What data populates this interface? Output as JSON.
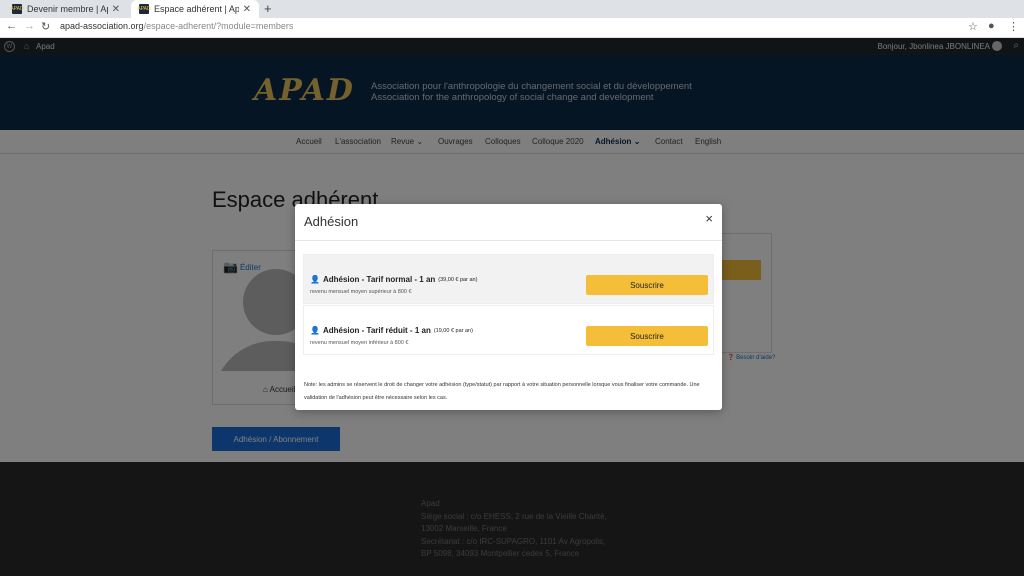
{
  "browser": {
    "tabs": [
      {
        "title": "Devenir membre | Apad",
        "close": "✕",
        "favicon": "APAD"
      },
      {
        "title": "Espace adhérent | Apad",
        "close": "✕",
        "favicon": "APAD"
      }
    ],
    "new_tab": "+",
    "url_host": "apad-association.org",
    "url_path": "/espace-adherent/?module=members"
  },
  "wpbar": {
    "site_name": "Apad",
    "greeting": "Bonjour, Jbonlinea JBONLINEA"
  },
  "header": {
    "logo": "APAD",
    "tagline_fr": "Association pour l'anthropologie du changement social et du développement",
    "tagline_en": "Association for the anthropology of social change and development"
  },
  "nav": {
    "items": [
      "Accueil",
      "L'association",
      "Revue",
      "Ouvrages",
      "Colloques",
      "Colloque 2020",
      "Adhésion",
      "Contact",
      "English"
    ]
  },
  "page": {
    "title": "Espace adhérent",
    "edit_label": "Éditer",
    "home_label": "Accueil",
    "subscription_button": "Adhésion / Abonnement",
    "help_label": "Besoin d'aide?"
  },
  "footer": {
    "lines": [
      "Apad",
      "Siège social : c/o EHESS, 2 rue de la Vieille Charité,",
      "13002 Marseille, France",
      "Secrétariat : c/o IRC-SUPAGRO, 1101 Av Agropolis,",
      "BP 5098, 34093 Montpellier cedex 5, France"
    ]
  },
  "modal": {
    "title": "Adhésion",
    "close": "×",
    "plans": [
      {
        "name": "Adhésion - Tarif normal - 1 an",
        "price": "(39,00 € par an)",
        "desc": "revenu mensuel moyen supérieur à 800 €",
        "button": "Souscrire"
      },
      {
        "name": "Adhésion - Tarif réduit - 1 an",
        "price": "(19,00 € par an)",
        "desc": "revenu mensuel moyen inférieur à 800 €",
        "button": "Souscrire"
      }
    ],
    "note": "Note: les admins se réservent le droit de changer votre adhésion (type/statut) par rapport à votre situation personnelle lorsque vous finaliser votre commande. Une validation de l'adhésion peut être nécessaire selon les cas."
  }
}
